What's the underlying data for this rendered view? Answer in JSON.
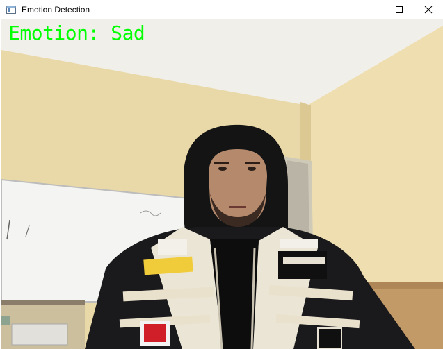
{
  "window": {
    "title": "Emotion Detection",
    "icons": {
      "app": "app-window-icon",
      "minimize": "minimize-icon",
      "maximize": "maximize-icon",
      "close": "close-icon"
    }
  },
  "overlay": {
    "emotion_label": "Emotion: Sad",
    "label_color": "#00ff00"
  }
}
